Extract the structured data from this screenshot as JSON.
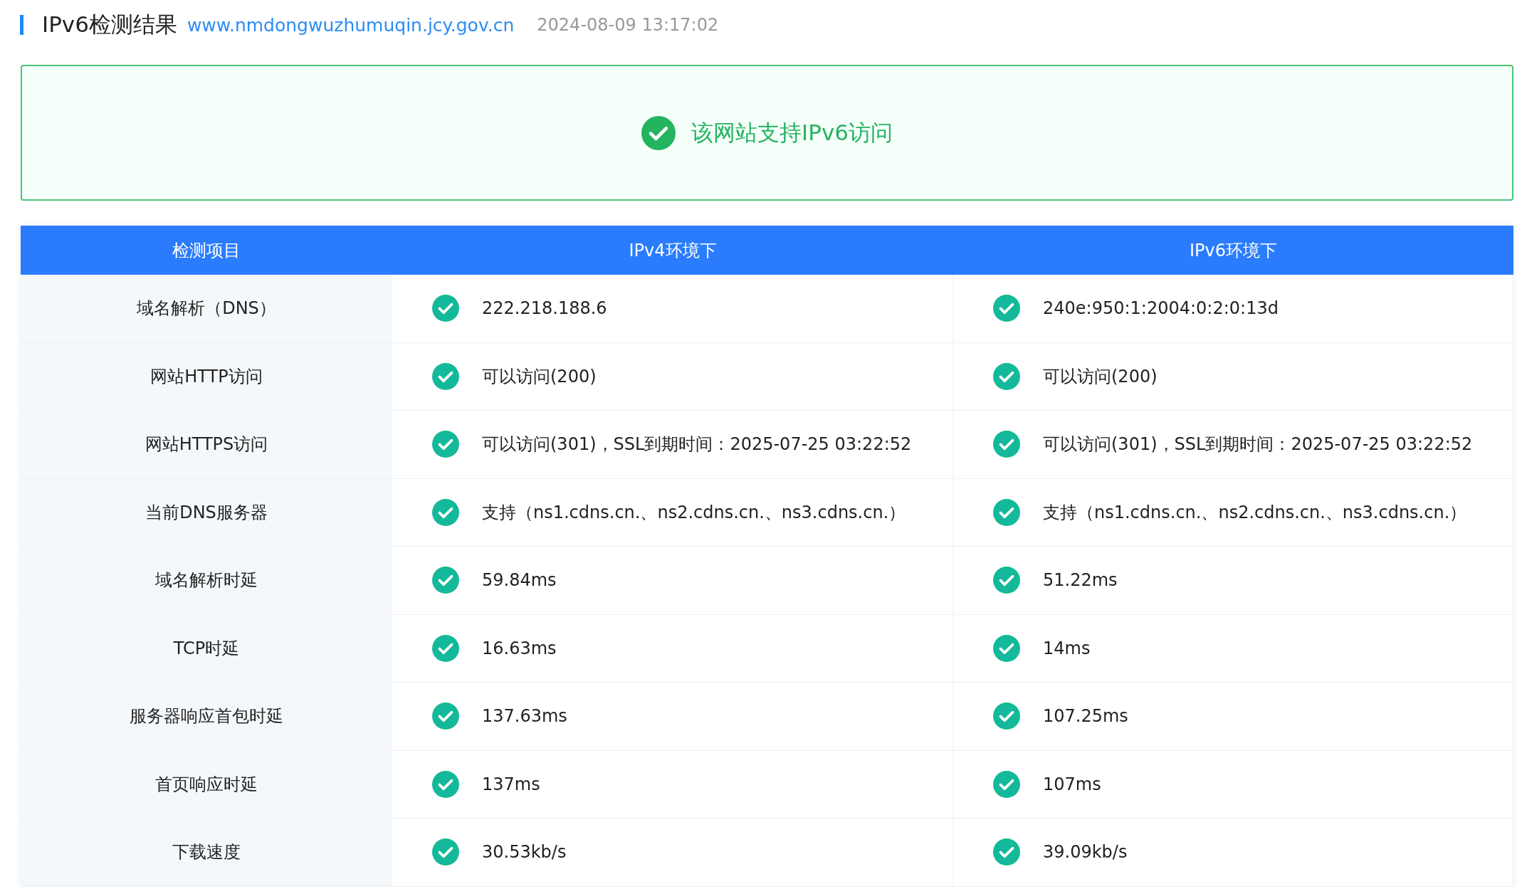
{
  "header": {
    "title": "IPv6检测结果",
    "url": "www.nmdongwuzhumuqin.jcy.gov.cn",
    "time": "2024-08-09 13:17:02"
  },
  "banner": {
    "ok": true,
    "message": "该网站支持IPv6访问"
  },
  "table": {
    "columns": [
      "检测项目",
      "IPv4环境下",
      "IPv6环境下"
    ],
    "rows": [
      {
        "item": "域名解析（DNS）",
        "ipv4": {
          "ok": true,
          "value": "222.218.188.6"
        },
        "ipv6": {
          "ok": true,
          "value": "240e:950:1:2004:0:2:0:13d"
        }
      },
      {
        "item": "网站HTTP访问",
        "ipv4": {
          "ok": true,
          "value": "可以访问(200)"
        },
        "ipv6": {
          "ok": true,
          "value": "可以访问(200)"
        }
      },
      {
        "item": "网站HTTPS访问",
        "ipv4": {
          "ok": true,
          "value": "可以访问(301)，SSL到期时间：2025-07-25 03:22:52"
        },
        "ipv6": {
          "ok": true,
          "value": "可以访问(301)，SSL到期时间：2025-07-25 03:22:52"
        }
      },
      {
        "item": "当前DNS服务器",
        "ipv4": {
          "ok": true,
          "value": "支持（ns1.cdns.cn.、ns2.cdns.cn.、ns3.cdns.cn.）"
        },
        "ipv6": {
          "ok": true,
          "value": "支持（ns1.cdns.cn.、ns2.cdns.cn.、ns3.cdns.cn.）"
        }
      },
      {
        "item": "域名解析时延",
        "ipv4": {
          "ok": true,
          "value": "59.84ms"
        },
        "ipv6": {
          "ok": true,
          "value": "51.22ms"
        }
      },
      {
        "item": "TCP时延",
        "ipv4": {
          "ok": true,
          "value": "16.63ms"
        },
        "ipv6": {
          "ok": true,
          "value": "14ms"
        }
      },
      {
        "item": "服务器响应首包时延",
        "ipv4": {
          "ok": true,
          "value": "137.63ms"
        },
        "ipv6": {
          "ok": true,
          "value": "107.25ms"
        }
      },
      {
        "item": "首页响应时延",
        "ipv4": {
          "ok": true,
          "value": "137ms"
        },
        "ipv6": {
          "ok": true,
          "value": "107ms"
        }
      },
      {
        "item": "下载速度",
        "ipv4": {
          "ok": true,
          "value": "30.53kb/s"
        },
        "ipv6": {
          "ok": true,
          "value": "39.09kb/s"
        }
      }
    ]
  }
}
